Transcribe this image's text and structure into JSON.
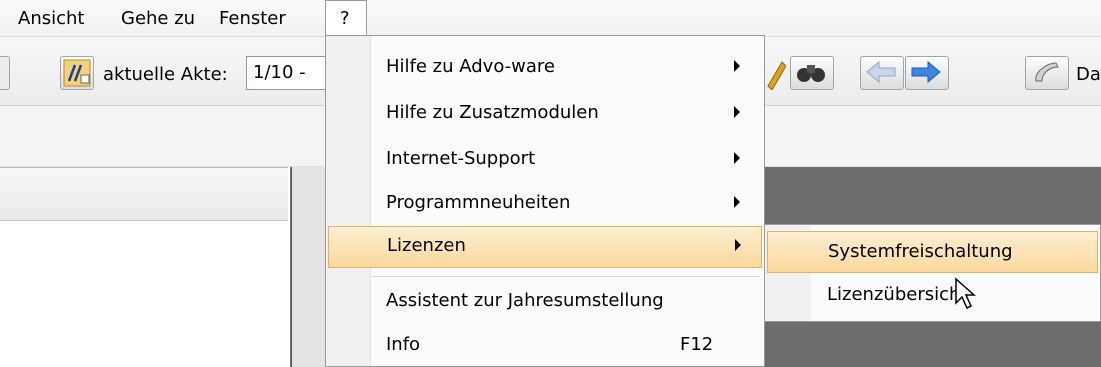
{
  "menubar": {
    "items": [
      {
        "label": "Ansicht"
      },
      {
        "label": "Gehe zu"
      },
      {
        "label": "Fenster"
      },
      {
        "label": "?"
      }
    ]
  },
  "toolbar": {
    "akte_label": "aktuelle Akte:",
    "akte_value": "1/10 -",
    "trailing_text": "Da"
  },
  "help_menu": {
    "items": [
      {
        "label": "Hilfe zu Advo-ware",
        "submenu": true
      },
      {
        "label": "Hilfe zu Zusatzmodulen",
        "submenu": true
      },
      {
        "label": "Internet-Support",
        "submenu": true
      },
      {
        "label": "Programmneuheiten",
        "submenu": true
      },
      {
        "label": "Lizenzen",
        "submenu": true,
        "highlighted": true
      },
      {
        "label": "Assistent zur Jahresumstellung"
      },
      {
        "label": "Info",
        "shortcut": "F12"
      }
    ]
  },
  "lizenzen_submenu": {
    "items": [
      {
        "label": "Systemfreischaltung",
        "highlighted": true
      },
      {
        "label": "Lizenzübersicht"
      }
    ]
  },
  "colors": {
    "highlight": "#fbd89c",
    "workspace": "#6d6d6d"
  }
}
